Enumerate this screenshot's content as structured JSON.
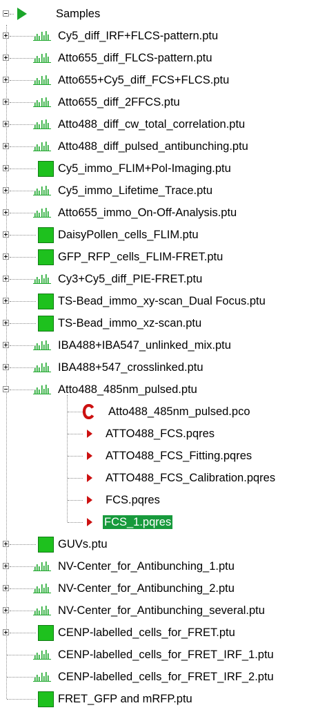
{
  "root": {
    "label": "Samples",
    "icon": "green-play-icon",
    "expanded": true
  },
  "colors": {
    "icon_green": "#1ba62a",
    "square_green": "#1ec11e",
    "arrow_red": "#cc1111",
    "selection_green": "#179a3c",
    "tree_line": "#8c8c8c"
  },
  "items": [
    {
      "label": "Cy5_diff_IRF+FLCS-pattern.ptu",
      "icon": "histogram-icon",
      "expander": "plus"
    },
    {
      "label": "Atto655_diff_FLCS-pattern.ptu",
      "icon": "histogram-icon",
      "expander": "plus"
    },
    {
      "label": "Atto655+Cy5_diff_FCS+FLCS.ptu",
      "icon": "histogram-icon",
      "expander": "plus"
    },
    {
      "label": "Atto655_diff_2FFCS.ptu",
      "icon": "histogram-icon",
      "expander": "plus"
    },
    {
      "label": "Atto488_diff_cw_total_correlation.ptu",
      "icon": "histogram-icon",
      "expander": "plus"
    },
    {
      "label": "Atto488_diff_pulsed_antibunching.ptu",
      "icon": "histogram-icon",
      "expander": "plus"
    },
    {
      "label": "Cy5_immo_FLIM+Pol-Imaging.ptu",
      "icon": "green-square-icon",
      "expander": "plus"
    },
    {
      "label": "Cy5_immo_Lifetime_Trace.ptu",
      "icon": "histogram-icon",
      "expander": "plus"
    },
    {
      "label": "Atto655_immo_On-Off-Analysis.ptu",
      "icon": "histogram-icon",
      "expander": "plus"
    },
    {
      "label": "DaisyPollen_cells_FLIM.ptu",
      "icon": "green-square-icon",
      "expander": "plus"
    },
    {
      "label": "GFP_RFP_cells_FLIM-FRET.ptu",
      "icon": "green-square-icon",
      "expander": "plus"
    },
    {
      "label": "Cy3+Cy5_diff_PIE-FRET.ptu",
      "icon": "histogram-icon",
      "expander": "plus"
    },
    {
      "label": "TS-Bead_immo_xy-scan_Dual Focus.ptu",
      "icon": "green-square-icon",
      "expander": "plus"
    },
    {
      "label": "TS-Bead_immo_xz-scan.ptu",
      "icon": "green-square-icon",
      "expander": "plus"
    },
    {
      "label": "IBA488+IBA547_unlinked_mix.ptu",
      "icon": "histogram-icon",
      "expander": "plus"
    },
    {
      "label": "IBA488+547_crosslinked.ptu",
      "icon": "histogram-icon",
      "expander": "plus"
    },
    {
      "label": "Atto488_485nm_pulsed.ptu",
      "icon": "histogram-icon",
      "expander": "minus",
      "children": [
        {
          "label": "Atto488_485nm_pulsed.pco",
          "icon": "red-c-icon"
        },
        {
          "label": "ATTO488_FCS.pqres",
          "icon": "red-arrow-icon"
        },
        {
          "label": "ATTO488_FCS_Fitting.pqres",
          "icon": "red-arrow-icon"
        },
        {
          "label": "ATTO488_FCS_Calibration.pqres",
          "icon": "red-arrow-icon"
        },
        {
          "label": "FCS.pqres",
          "icon": "red-arrow-icon"
        },
        {
          "label": "FCS_1.pqres",
          "icon": "red-arrow-icon",
          "selected": true
        }
      ]
    },
    {
      "label": "GUVs.ptu",
      "icon": "green-square-icon",
      "expander": "plus"
    },
    {
      "label": "NV-Center_for_Antibunching_1.ptu",
      "icon": "histogram-icon",
      "expander": "plus"
    },
    {
      "label": "NV-Center_for_Antibunching_2.ptu",
      "icon": "histogram-icon",
      "expander": "plus"
    },
    {
      "label": "NV-Center_for_Antibunching_several.ptu",
      "icon": "histogram-icon",
      "expander": "plus"
    },
    {
      "label": "CENP-labelled_cells_for_FRET.ptu",
      "icon": "green-square-icon",
      "expander": "plus"
    },
    {
      "label": "CENP-labelled_cells_for_FRET_IRF_1.ptu",
      "icon": "histogram-icon",
      "expander": "none"
    },
    {
      "label": "CENP-labelled_cells_for_FRET_IRF_2.ptu",
      "icon": "histogram-icon",
      "expander": "none"
    },
    {
      "label": "FRET_GFP and mRFP.ptu",
      "icon": "green-square-icon",
      "expander": "none"
    }
  ]
}
